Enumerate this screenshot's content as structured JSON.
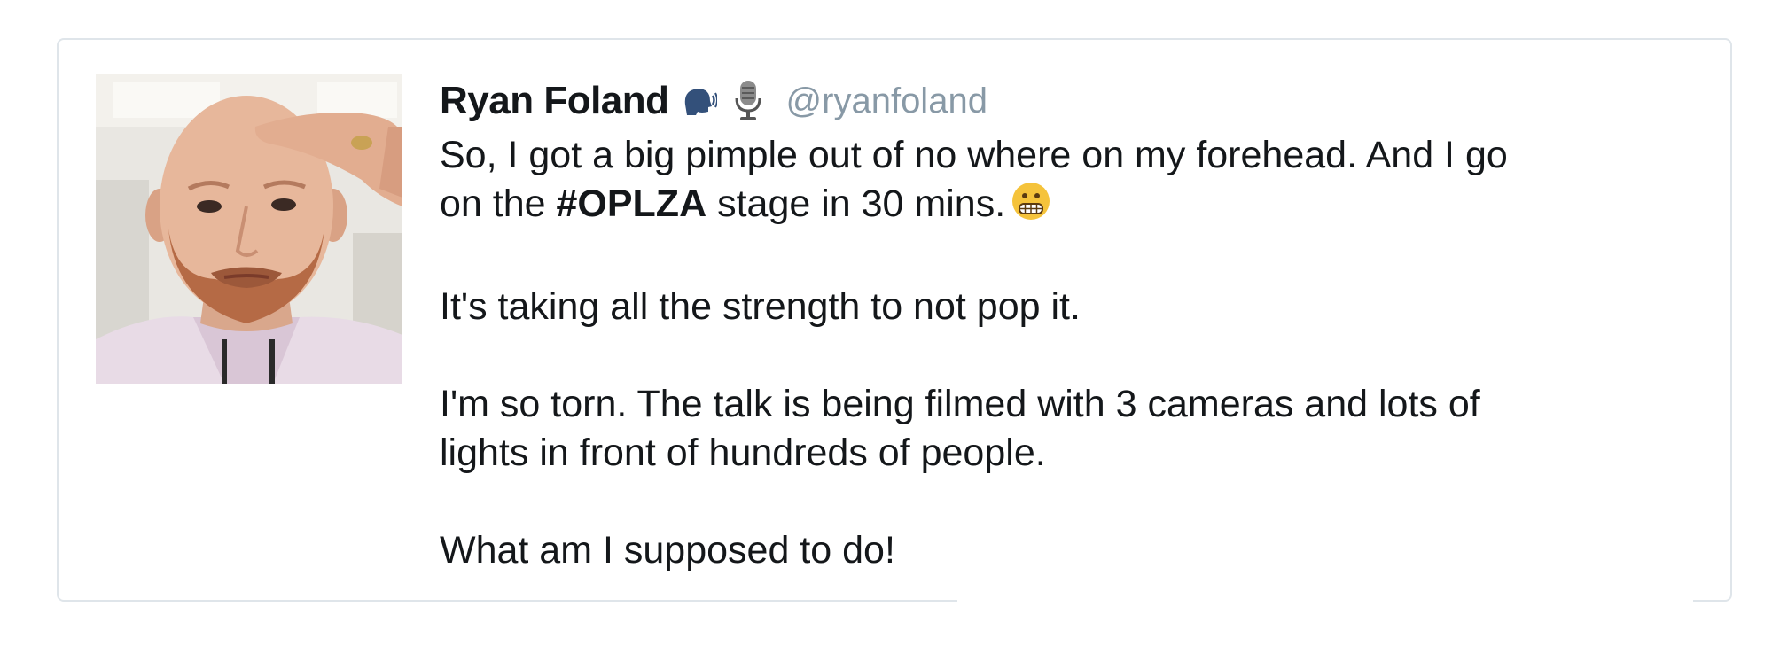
{
  "tweet": {
    "author": {
      "name": "Ryan Foland",
      "handle": "@ryanfoland",
      "name_emojis": [
        "speaking-head-icon",
        "microphone-icon"
      ]
    },
    "line1": "So, I got a big pimple out of no where on my forehead. And I go",
    "line2_prefix": "on the ",
    "hashtag": "#OPLZA",
    "line2_suffix": " stage in 30 mins.",
    "line2_emoji": "grimacing-face-icon",
    "paragraph2": "It's taking all the strength to not pop it.",
    "paragraph3_line1": "I'm so torn. The talk is being filmed with 3 cameras and lots of",
    "paragraph3_line2": "lights in front of hundreds of people.",
    "paragraph4": "What am I supposed to do!"
  },
  "colors": {
    "text": "#14171a",
    "handle": "#8899a6",
    "border": "#dfe5ea"
  }
}
